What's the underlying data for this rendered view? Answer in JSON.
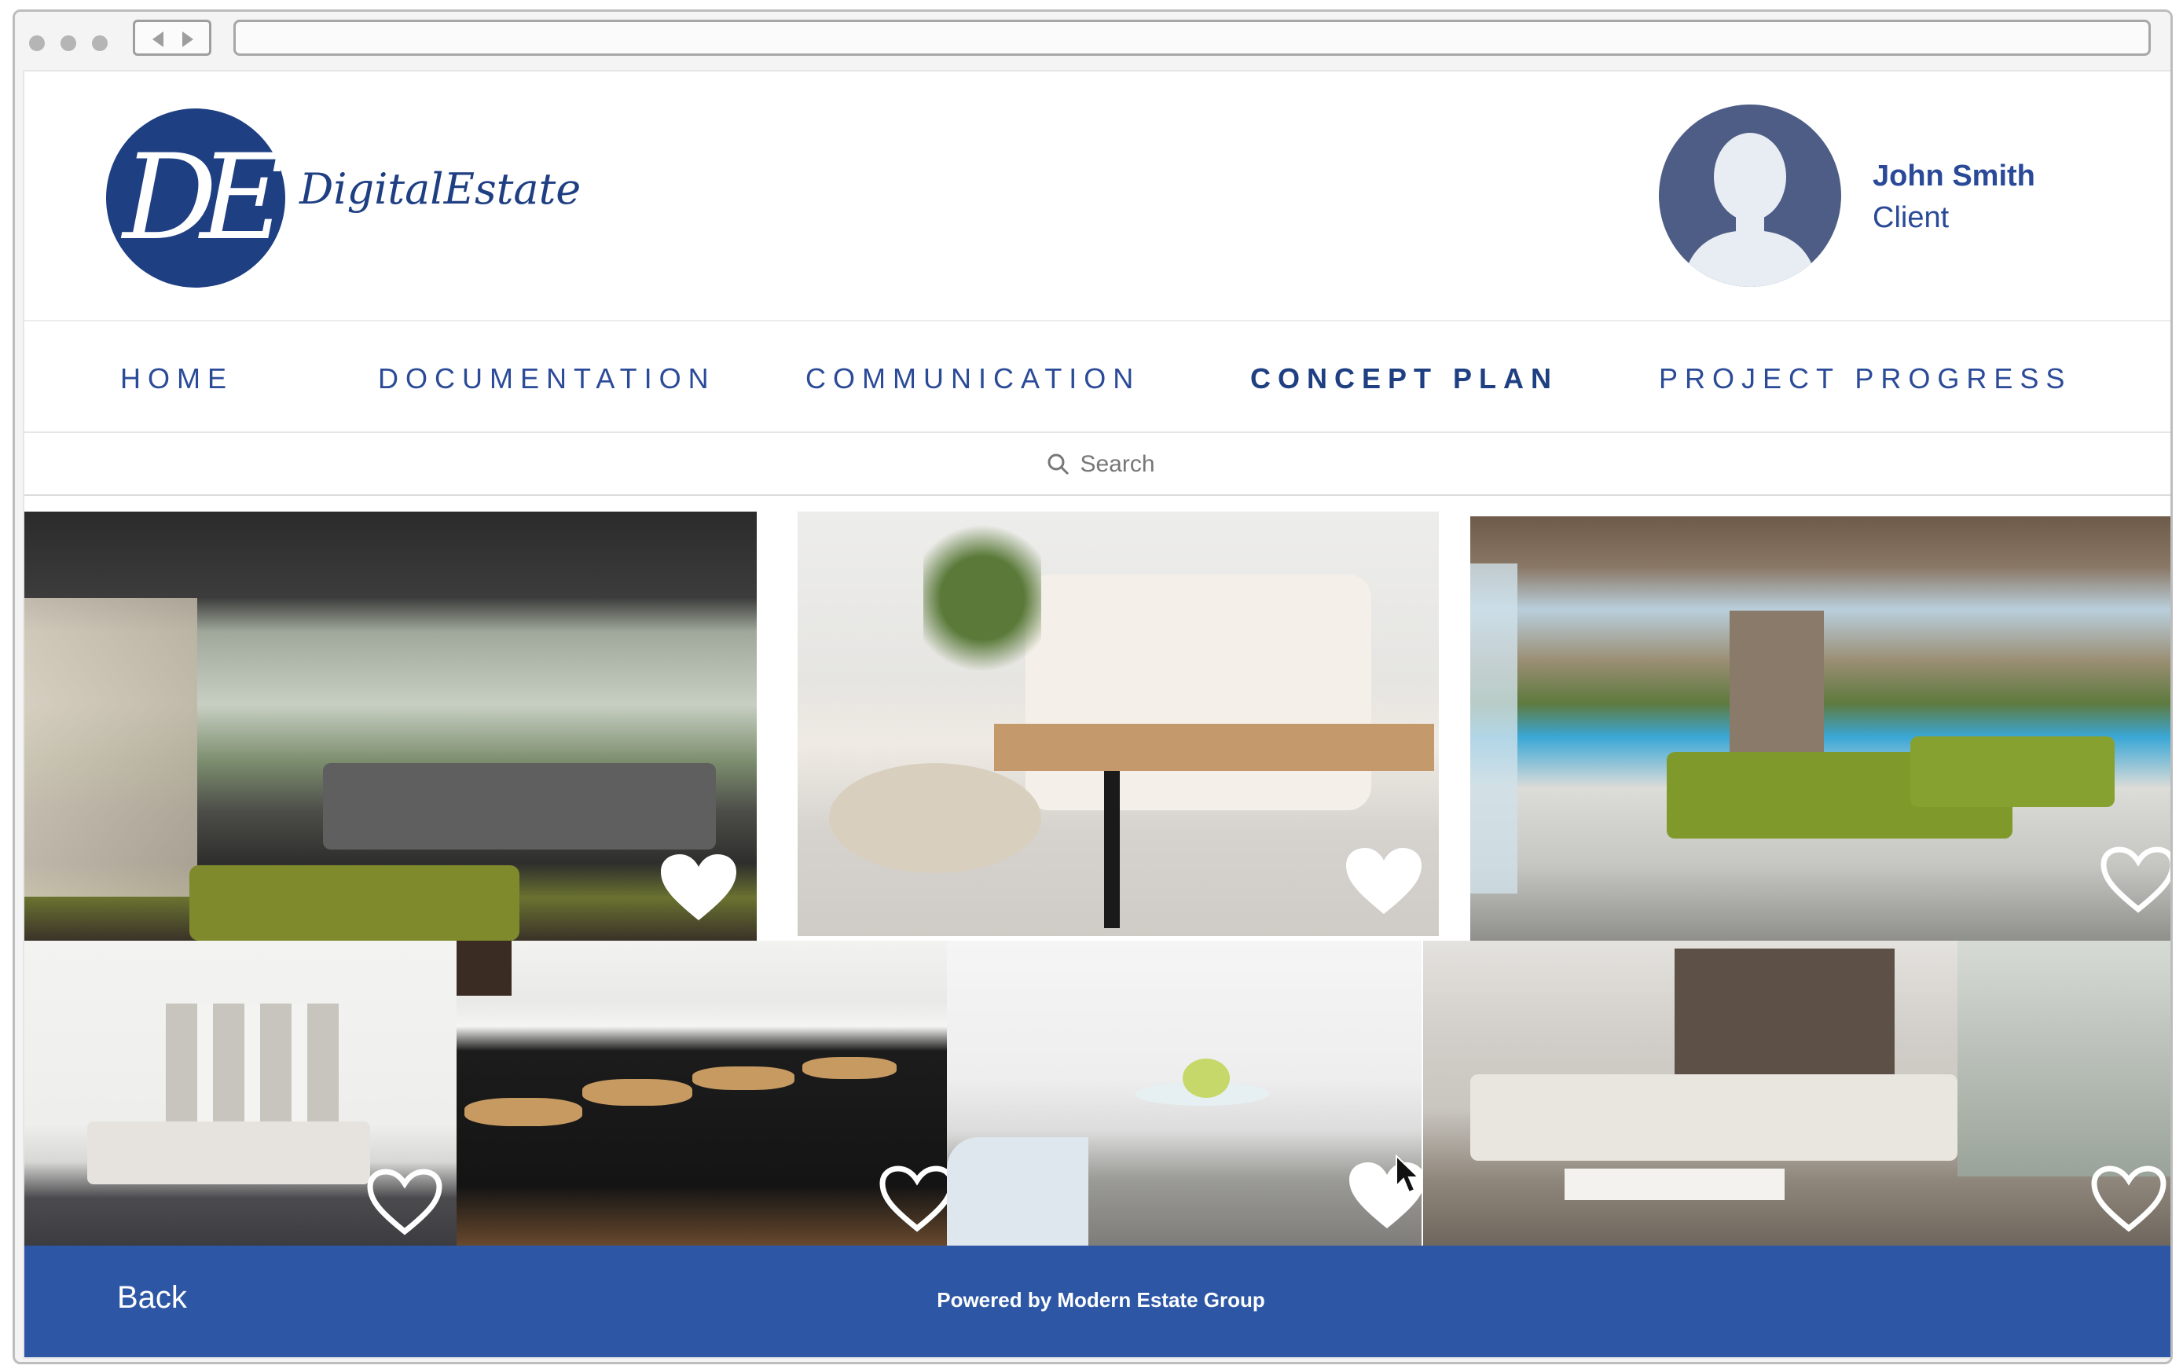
{
  "brand": {
    "logo_letters": "DE",
    "name": "DigitalEstate"
  },
  "user": {
    "name": "John Smith",
    "role": "Client"
  },
  "nav": {
    "items": [
      {
        "label": "HOME",
        "active": false
      },
      {
        "label": "DOCUMENTATION",
        "active": false
      },
      {
        "label": "COMMUNICATION",
        "active": false
      },
      {
        "label": "CONCEPT PLAN",
        "active": true
      },
      {
        "label": "PROJECT PROGRESS",
        "active": false
      }
    ]
  },
  "search": {
    "placeholder": "Search"
  },
  "gallery": {
    "tiles": [
      {
        "name": "living-room-forest-view",
        "favorited": true
      },
      {
        "name": "bedroom-bench",
        "favorited": true
      },
      {
        "name": "poolside-lounge",
        "favorited": false
      },
      {
        "name": "gallery-wall-living-room",
        "favorited": false
      },
      {
        "name": "kitchen-bar-stools",
        "favorited": false
      },
      {
        "name": "white-dining-kitchen",
        "favorited": true
      },
      {
        "name": "white-sectional-lounge",
        "favorited": false
      }
    ]
  },
  "footer": {
    "back_label": "Back",
    "powered_by": "Powered by Modern Estate Group"
  },
  "colors": {
    "brand_blue": "#1f3f83",
    "nav_blue": "#2b4b99",
    "footer_blue": "#2d57a5"
  }
}
